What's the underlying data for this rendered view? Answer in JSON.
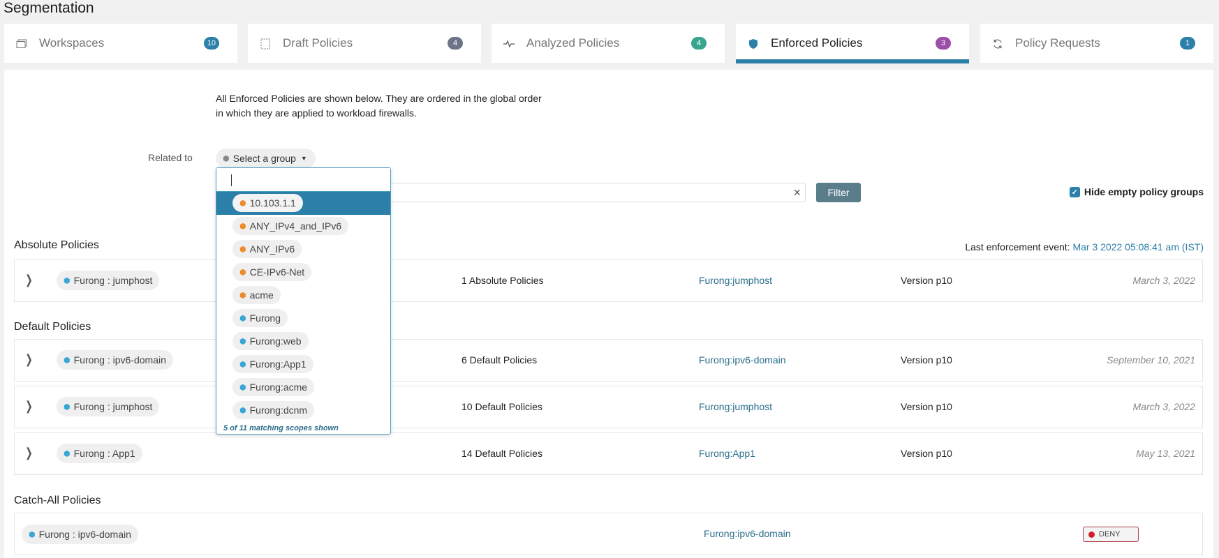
{
  "page": {
    "title": "Segmentation"
  },
  "tabs": [
    {
      "label": "Workspaces",
      "icon": "workspaces-icon",
      "count": "10",
      "badge_color": "#2b7fa8",
      "active": false
    },
    {
      "label": "Draft Policies",
      "icon": "draft-icon",
      "count": "4",
      "badge_color": "#6b7488",
      "active": false
    },
    {
      "label": "Analyzed Policies",
      "icon": "pulse-icon",
      "count": "4",
      "badge_color": "#3aa58f",
      "active": false
    },
    {
      "label": "Enforced Policies",
      "icon": "shield-icon",
      "count": "3",
      "badge_color": "#9b4fa8",
      "active": true
    },
    {
      "label": "Policy Requests",
      "icon": "refresh-icon",
      "count": "1",
      "badge_color": "#2b7fa8",
      "active": false
    }
  ],
  "description": "All Enforced Policies are shown below. They are ordered in the global order in which they are applied to workload firewalls.",
  "filter": {
    "related_label": "Related to",
    "select_label": "Select a group",
    "search_value": "",
    "filter_button": "Filter",
    "hide_empty_label": "Hide empty policy groups",
    "hide_empty_checked": true
  },
  "dropdown": {
    "input_value": "",
    "items": [
      {
        "label": "10.103.1.1",
        "type": "orange",
        "selected": true
      },
      {
        "label": "ANY_IPv4_and_IPv6",
        "type": "orange",
        "selected": false
      },
      {
        "label": "ANY_IPv6",
        "type": "orange",
        "selected": false
      },
      {
        "label": "CE-IPv6-Net",
        "type": "orange",
        "selected": false
      },
      {
        "label": "acme",
        "type": "orange",
        "selected": false
      },
      {
        "label": "Furong",
        "type": "blue",
        "selected": false
      },
      {
        "label": "Furong:web",
        "type": "blue",
        "selected": false
      },
      {
        "label": "Furong:App1",
        "type": "blue",
        "selected": false
      },
      {
        "label": "Furong:acme",
        "type": "blue",
        "selected": false
      },
      {
        "label": "Furong:dcnm",
        "type": "blue",
        "selected": false
      }
    ],
    "footer": "5 of 11 matching scopes shown"
  },
  "last_event": {
    "label": "Last enforcement event:",
    "value": "Mar 3 2022 05:08:41 am (IST)"
  },
  "sections": {
    "absolute": {
      "heading": "Absolute Policies",
      "rows": [
        {
          "scope": "Furong : jumphost",
          "count": "1 Absolute Policies",
          "link": "Furong:jumphost",
          "version": "Version p10",
          "date": "March 3, 2022"
        }
      ]
    },
    "default": {
      "heading": "Default Policies",
      "rows": [
        {
          "scope": "Furong : ipv6-domain",
          "count": "6 Default Policies",
          "link": "Furong:ipv6-domain",
          "version": "Version p10",
          "date": "September 10, 2021"
        },
        {
          "scope": "Furong : jumphost",
          "count": "10 Default Policies",
          "link": "Furong:jumphost",
          "version": "Version p10",
          "date": "March 3, 2022"
        },
        {
          "scope": "Furong : App1",
          "count": "14 Default Policies",
          "link": "Furong:App1",
          "version": "Version p10",
          "date": "May 13, 2021"
        }
      ]
    },
    "catchall": {
      "heading": "Catch-All Policies",
      "rows": [
        {
          "scope": "Furong : ipv6-domain",
          "link": "Furong:ipv6-domain",
          "action": "DENY"
        }
      ]
    }
  }
}
